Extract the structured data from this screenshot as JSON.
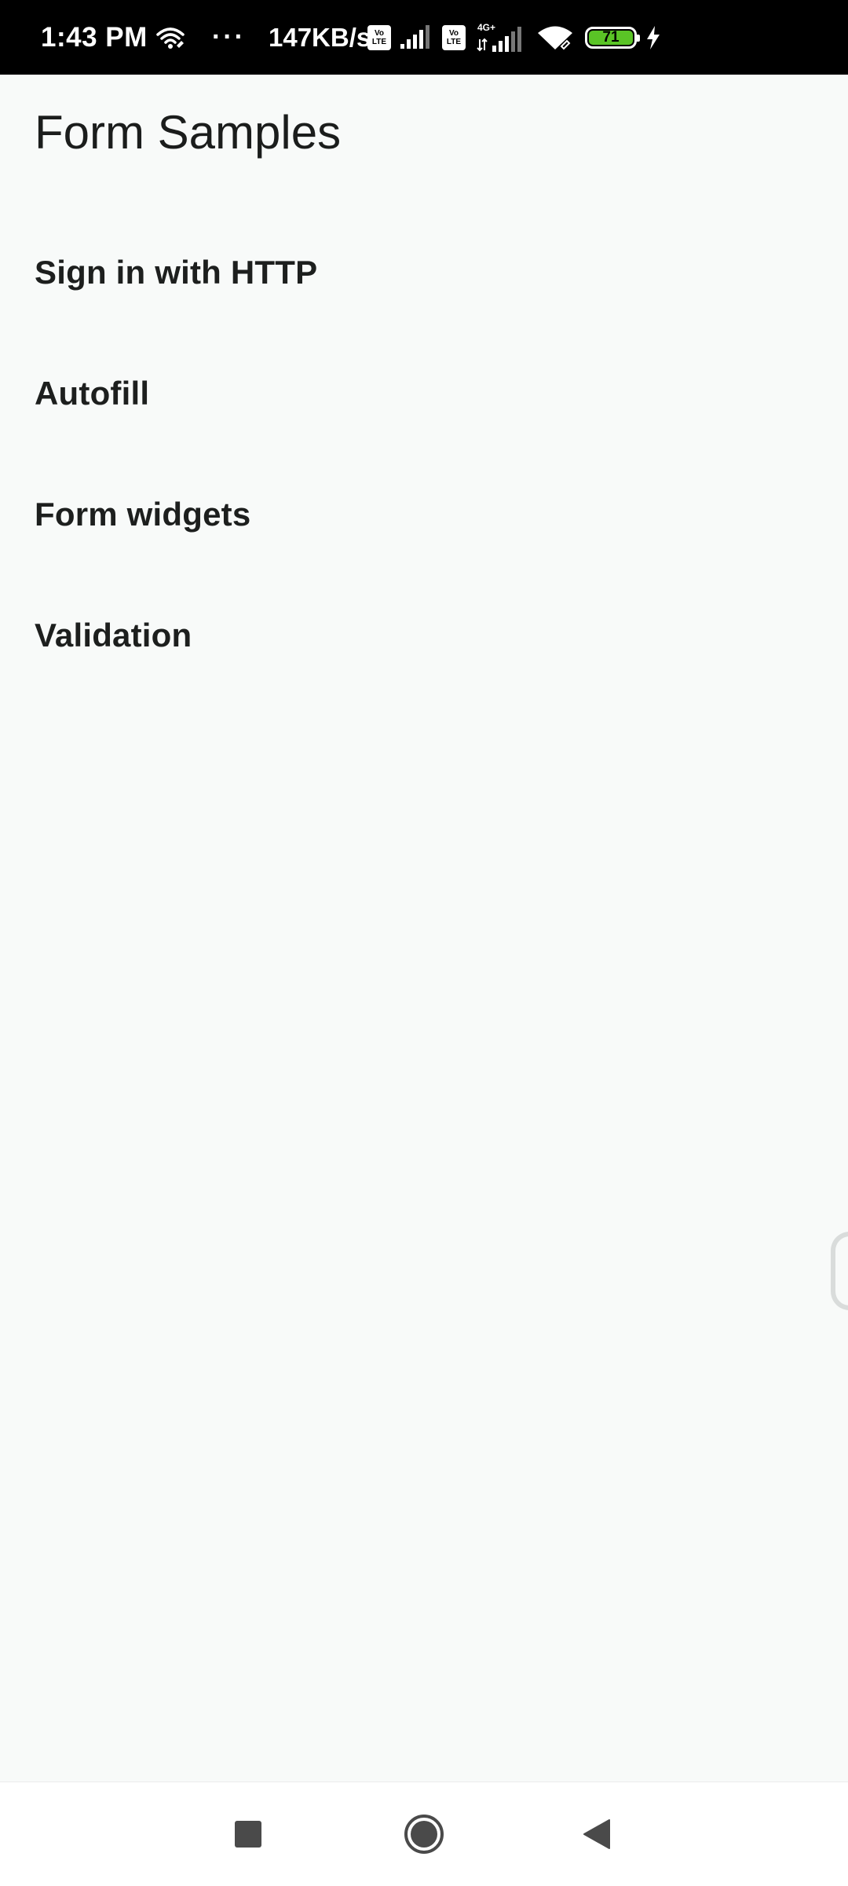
{
  "status_bar": {
    "time": "1:43 PM",
    "more_dots": "···",
    "network_speed": "147KB/s",
    "volte_label": "Vo LTE",
    "network_type": "4G+",
    "battery_level": "71",
    "battery_color": "#5ac426",
    "icons": [
      "wifi-hotspot-icon",
      "volte-icon",
      "signal-icon",
      "volte-icon",
      "signal-4g-icon",
      "wifi-icon",
      "battery-icon",
      "charging-bolt-icon"
    ]
  },
  "app": {
    "title": "Form Samples"
  },
  "samples": [
    {
      "label": "Sign in with HTTP"
    },
    {
      "label": "Autofill"
    },
    {
      "label": "Form widgets"
    },
    {
      "label": "Validation"
    }
  ],
  "nav_bar": {
    "icons": [
      "recents-square-icon",
      "home-circle-icon",
      "back-triangle-icon"
    ]
  }
}
